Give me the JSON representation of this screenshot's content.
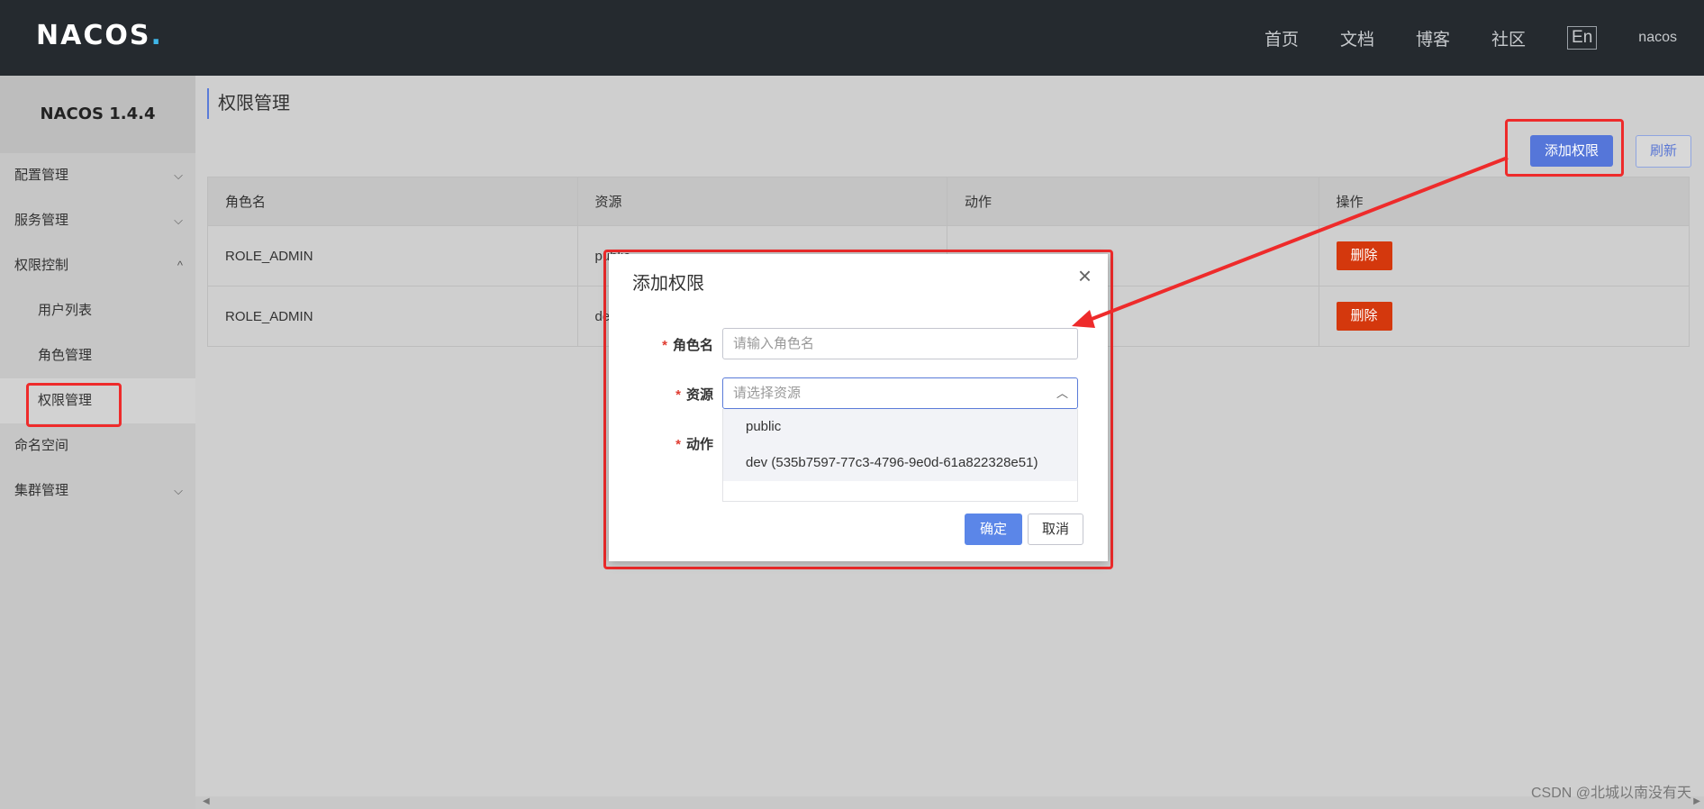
{
  "topbar": {
    "logo_main": "NACOS",
    "logo_dot": ".",
    "nav": [
      "首页",
      "文档",
      "博客",
      "社区"
    ],
    "lang": "En",
    "user": "nacos"
  },
  "sidebar": {
    "brand": "NACOS 1.4.4",
    "items": [
      {
        "label": "配置管理",
        "chevron": "⌵"
      },
      {
        "label": "服务管理",
        "chevron": "⌵"
      },
      {
        "label": "权限控制",
        "chevron": "^"
      },
      {
        "label": "用户列表"
      },
      {
        "label": "角色管理"
      },
      {
        "label": "权限管理"
      },
      {
        "label": "命名空间"
      },
      {
        "label": "集群管理",
        "chevron": "⌵"
      }
    ]
  },
  "main": {
    "title": "权限管理",
    "add_button": "添加权限",
    "refresh_button": "刷新",
    "table": {
      "headers": [
        "角色名",
        "资源",
        "动作",
        "操作"
      ],
      "rows": [
        {
          "role": "ROLE_ADMIN",
          "resource": "public",
          "action": "",
          "op": "删除"
        },
        {
          "role": "ROLE_ADMIN",
          "resource": "dev",
          "action": "",
          "op": "删除"
        }
      ]
    }
  },
  "dialog": {
    "title": "添加权限",
    "close": "×",
    "required_mark": "*",
    "role_label": "角色名",
    "role_placeholder": "请输入角色名",
    "resource_label": "资源",
    "resource_placeholder": "请选择资源",
    "action_label": "动作",
    "options": [
      "public",
      "dev (535b7597-77c3-4796-9e0d-61a822328e51)"
    ],
    "ok_button": "确定",
    "cancel_button": "取消"
  },
  "watermark": "CSDN @北城以南没有天",
  "colors": {
    "topbar": "#252a2f",
    "primary": "#5576d9",
    "danger": "#d4380d",
    "highlight": "#ee2b2b"
  }
}
